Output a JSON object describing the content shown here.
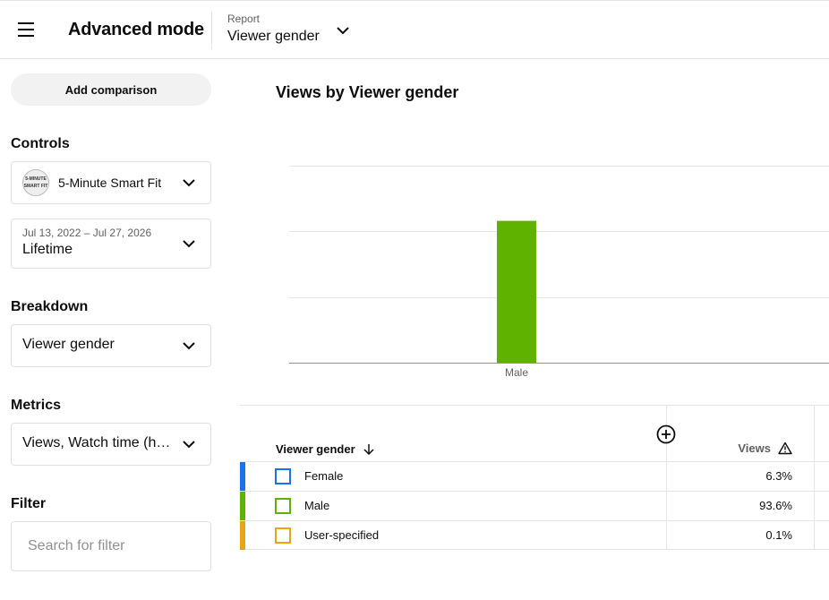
{
  "header": {
    "title": "Advanced mode",
    "report_label": "Report",
    "report_value": "Viewer gender"
  },
  "sidebar": {
    "add_comparison": "Add comparison",
    "controls_label": "Controls",
    "channel": {
      "name": "5-Minute Smart Fit",
      "avatar_text": "5-MINUTE SMART FIT"
    },
    "date": {
      "range": "Jul 13, 2022 – Jul 27, 2026",
      "preset": "Lifetime"
    },
    "breakdown_label": "Breakdown",
    "breakdown_value": "Viewer gender",
    "metrics_label": "Metrics",
    "metrics_value": "Views, Watch time (h…",
    "filter_label": "Filter",
    "filter_placeholder": "Search for filter"
  },
  "chart_data": {
    "type": "bar",
    "title": "Views by Viewer gender",
    "categories": [
      "Male"
    ],
    "values": [
      93.6
    ],
    "ylim": [
      0,
      130
    ],
    "grid": true,
    "colors": [
      "#5fb300"
    ]
  },
  "table": {
    "dimension_header": "Viewer gender",
    "metric_header": "Views",
    "rows": [
      {
        "label": "Female",
        "value": "6.3%",
        "color": "#1a73e8"
      },
      {
        "label": "Male",
        "value": "93.6%",
        "color": "#5fb300"
      },
      {
        "label": "User-specified",
        "value": "0.1%",
        "color": "#e8a317"
      }
    ]
  }
}
